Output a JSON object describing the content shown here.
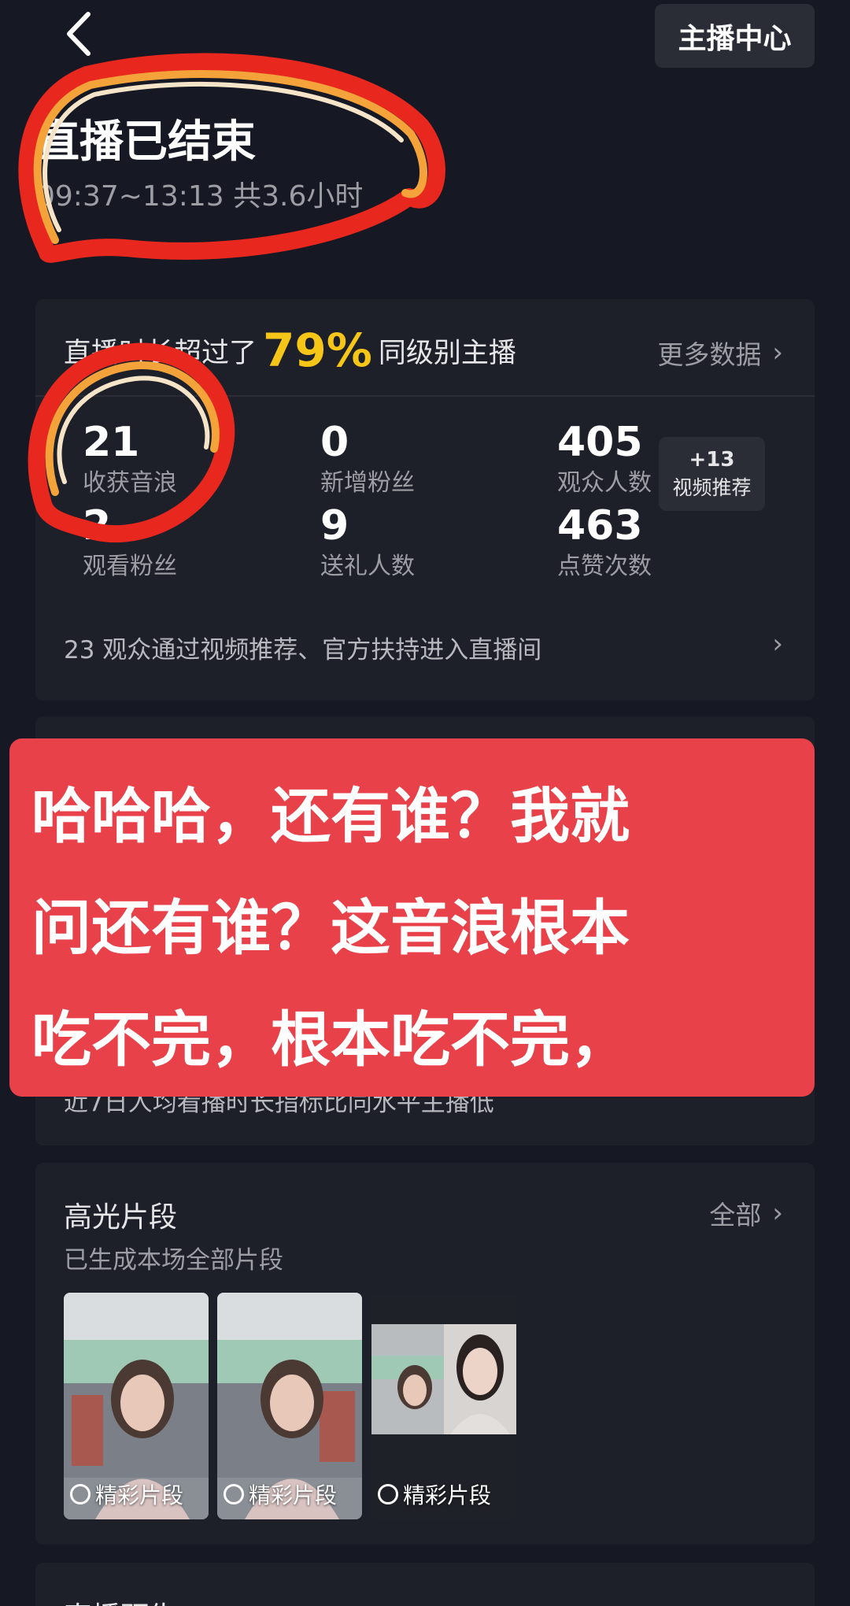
{
  "header": {
    "host_center_label": "主播中心",
    "title": "直播已结束",
    "time_range": "09:37~13:13 共3.6小时"
  },
  "stats_card": {
    "headline_prefix": "直播时长超过了",
    "headline_percent": "79%",
    "headline_suffix": "同级别主播",
    "more_data_label": "更多数据",
    "stats": [
      {
        "value": "21",
        "label": "收获音浪"
      },
      {
        "value": "0",
        "label": "新增粉丝"
      },
      {
        "value": "405",
        "label": "观众人数"
      },
      {
        "value": "2",
        "label": "观看粉丝"
      },
      {
        "value": "9",
        "label": "送礼人数"
      },
      {
        "value": "463",
        "label": "点赞次数"
      }
    ],
    "badge": {
      "value": "+13",
      "label": "视频推荐"
    },
    "entry_note": "23 观众通过视频推荐、官方扶持进入直播间"
  },
  "hidden_card": {
    "note": "近7日人均看播时长指标比同水平主播低"
  },
  "overlay_caption": {
    "lines": [
      "哈哈哈，还有谁？我就",
      "问还有谁？这音浪根本",
      "吃不完，根本吃不完，"
    ]
  },
  "highlights": {
    "title": "高光片段",
    "all_label": "全部",
    "subtitle": "已生成本场全部片段",
    "clips": [
      {
        "label": "精彩片段"
      },
      {
        "label": "精彩片段"
      },
      {
        "label": "精彩片段"
      }
    ]
  },
  "bottom_card": {
    "title": "直播预告"
  },
  "colors": {
    "background": "#161823",
    "card": "#1e2029",
    "accent_yellow": "#f5c518",
    "overlay_red": "#e8414a",
    "annotation_red": "#e8271e",
    "annotation_orange": "#f4a23a"
  },
  "icons": [
    "back-arrow-icon",
    "chevron-right-icon",
    "flame-icon"
  ]
}
